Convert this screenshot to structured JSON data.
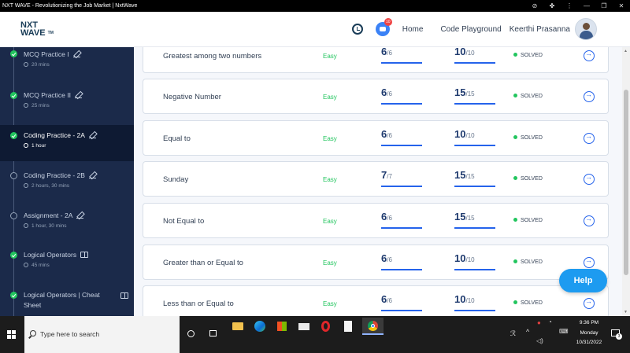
{
  "window": {
    "title": "NXT WAVE - Revolutionizing the Job Market | NxtWave",
    "controls": [
      "⊘",
      "✤",
      "⋮",
      "—",
      "❐",
      "✕"
    ]
  },
  "header": {
    "logo_top": "NXT",
    "logo_bottom": "WAVE",
    "logo_tm": "TM",
    "notification_count": "10",
    "nav": [
      "Home",
      "Code Playground"
    ],
    "user_name": "Keerthi Prasanna"
  },
  "sidebar": {
    "items": [
      {
        "label": "MCQ Practice I",
        "meta": "20 mins",
        "status": "done",
        "icon": "edit-icon"
      },
      {
        "label": "MCQ Practice II",
        "meta": "25 mins",
        "status": "done",
        "icon": "edit-icon"
      },
      {
        "label": "Coding Practice - 2A",
        "meta": "1 hour",
        "status": "done",
        "icon": "edit-icon",
        "active": true
      },
      {
        "label": "Coding Practice - 2B",
        "meta": "2 hours, 30 mins",
        "status": "open",
        "icon": "edit-icon"
      },
      {
        "label": "Assignment - 2A",
        "meta": "1 hour, 30 mins",
        "status": "open",
        "icon": "edit-icon"
      },
      {
        "label": "Logical Operators",
        "meta": "45 mins",
        "status": "done",
        "icon": "book-icon"
      },
      {
        "label": "Logical Operators | Cheat",
        "label2": "Sheet",
        "status": "done",
        "icon": "book-icon"
      }
    ]
  },
  "questions": [
    {
      "title": "Greatest among two numbers",
      "difficulty": "Easy",
      "tests": "6",
      "tests_total": "/6",
      "score": "10",
      "score_total": "/10",
      "status": "SOLVED"
    },
    {
      "title": "Negative Number",
      "difficulty": "Easy",
      "tests": "6",
      "tests_total": "/6",
      "score": "15",
      "score_total": "/15",
      "status": "SOLVED"
    },
    {
      "title": "Equal to",
      "difficulty": "Easy",
      "tests": "6",
      "tests_total": "/6",
      "score": "10",
      "score_total": "/10",
      "status": "SOLVED"
    },
    {
      "title": "Sunday",
      "difficulty": "Easy",
      "tests": "7",
      "tests_total": "/7",
      "score": "15",
      "score_total": "/15",
      "status": "SOLVED"
    },
    {
      "title": "Not Equal to",
      "difficulty": "Easy",
      "tests": "6",
      "tests_total": "/6",
      "score": "15",
      "score_total": "/15",
      "status": "SOLVED"
    },
    {
      "title": "Greater than or Equal to",
      "difficulty": "Easy",
      "tests": "6",
      "tests_total": "/6",
      "score": "10",
      "score_total": "/10",
      "status": "SOLVED"
    },
    {
      "title": "Less than or Equal to",
      "difficulty": "Easy",
      "tests": "6",
      "tests_total": "/6",
      "score": "10",
      "score_total": "/10",
      "status": "SOLVED"
    }
  ],
  "help_label": "Help",
  "taskbar": {
    "search_placeholder": "Type here to search",
    "time": "9:36 PM",
    "day": "Monday",
    "date": "10/31/2022",
    "notification_count": "3"
  },
  "colors": {
    "sidebar_bg": "#1b2a4a",
    "accent": "#2563eb",
    "easy": "#22c55e",
    "help": "#1d9bf0"
  }
}
